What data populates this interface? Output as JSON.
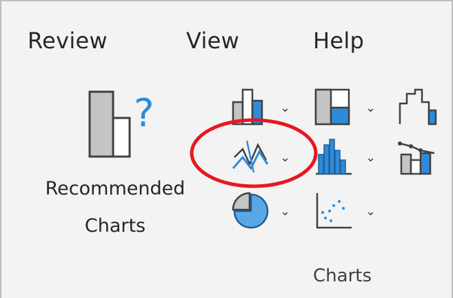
{
  "ribbon": {
    "tabs": [
      {
        "label": "Review"
      },
      {
        "label": "View"
      },
      {
        "label": "Help"
      }
    ],
    "group": {
      "name": "Charts",
      "recommended": {
        "line1": "Recommended",
        "line2": "Charts",
        "icon": "recommended-charts-icon"
      },
      "buttons": [
        {
          "icon": "column-bar-chart-icon"
        },
        {
          "icon": "hierarchy-chart-icon"
        },
        {
          "icon": "waterfall-chart-icon"
        },
        {
          "icon": "line-area-chart-icon"
        },
        {
          "icon": "statistic-chart-icon"
        },
        {
          "icon": "combo-chart-icon"
        },
        {
          "icon": "pie-doughnut-chart-icon"
        },
        {
          "icon": "scatter-bubble-chart-icon"
        }
      ]
    },
    "annotation": {
      "shape": "circle",
      "color": "#e5191f",
      "target": "line-area-chart-button"
    }
  },
  "colors": {
    "accent_blue": "#2e8bd9",
    "gray_fill": "#c4c4c4",
    "icon_dark": "#404040",
    "annotation_red": "#e5191f"
  }
}
